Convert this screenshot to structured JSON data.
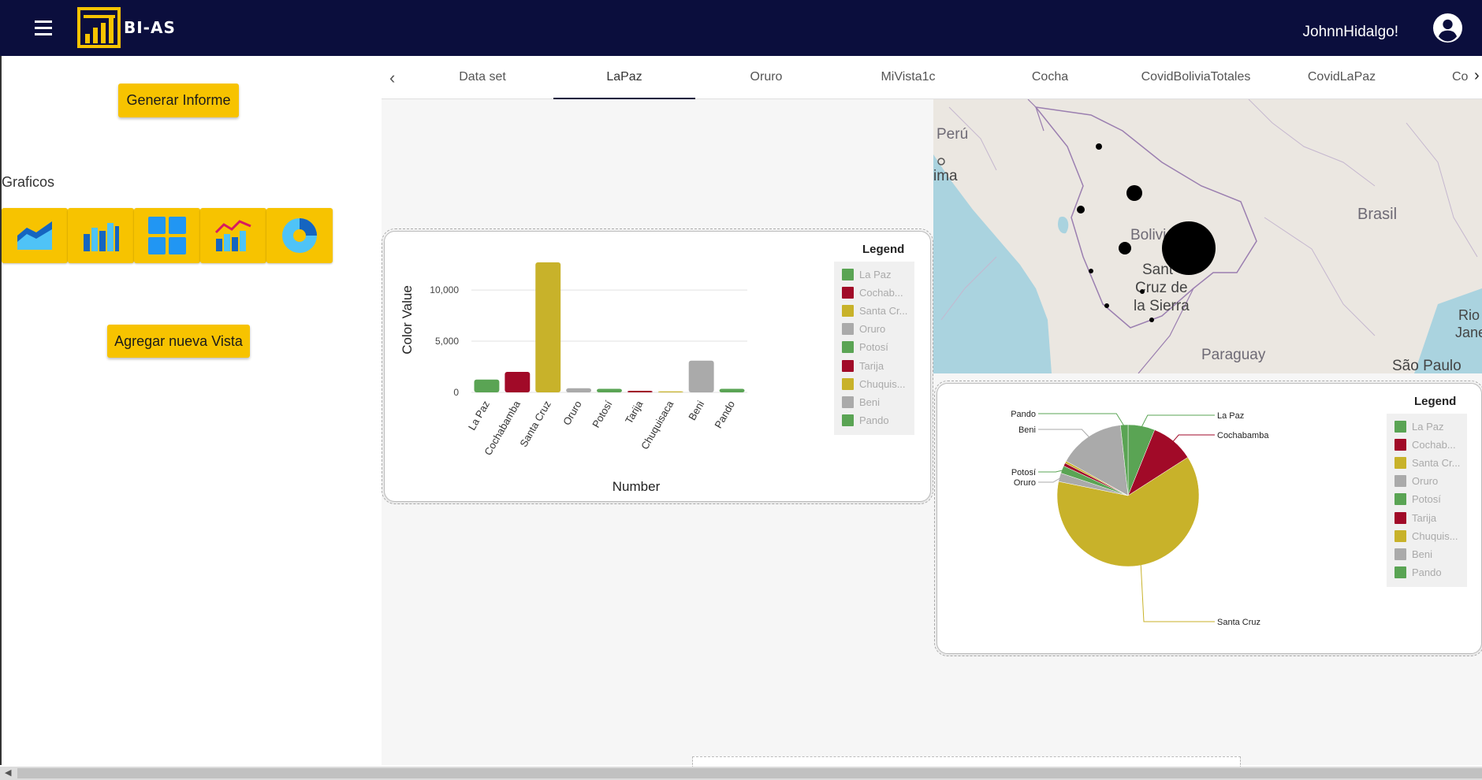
{
  "app": {
    "brand": "BI-AS",
    "user_greeting": "JohnnHidalgo!"
  },
  "colors": {
    "topbar": "#0b0e3d",
    "accent": "#f7c300",
    "series_green": "#5aa454",
    "series_red": "#a10a28",
    "series_yellow": "#c8b22a",
    "series_gray": "#aaaaaa"
  },
  "sidebar": {
    "generate_report": "Generar Informe",
    "charts_label": "Graficos",
    "add_view": "Agregar nueva Vista",
    "chart_types": [
      "area-chart-icon",
      "bar-chart-icon",
      "grid-chart-icon",
      "combo-chart-icon",
      "pie-chart-icon"
    ]
  },
  "tabs": [
    {
      "label": "Data set"
    },
    {
      "label": "LaPaz"
    },
    {
      "label": "Oruro"
    },
    {
      "label": "MiVista1c"
    },
    {
      "label": "Cocha"
    },
    {
      "label": "CovidBoliviaTotales"
    },
    {
      "label": "CovidLaPaz"
    },
    {
      "label": "Co"
    }
  ],
  "active_tab": "LaPaz",
  "map": {
    "labels": {
      "peru": "Perú",
      "lima": "ima",
      "brasil": "Brasil",
      "bolivia": "Bolivi",
      "santa_cruz_1": "Sant",
      "santa_cruz_2": "Cruz de",
      "santa_cruz_3": "la Sierra",
      "paraguay": "Paraguay",
      "sao_paulo": "São Paulo",
      "rio_1": "Rio",
      "rio_2": "Jane"
    }
  },
  "legend_title": "Legend",
  "legend_items": [
    "La Paz",
    "Cochab...",
    "Santa Cr...",
    "Oruro",
    "Potosí",
    "Tarija",
    "Chuquis...",
    "Beni",
    "Pando"
  ],
  "chart_data": [
    {
      "type": "bar",
      "categories": [
        "La Paz",
        "Cochabamba",
        "Santa Cruz",
        "Oruro",
        "Potosí",
        "Tarija",
        "Chuquisaca",
        "Beni",
        "Pando"
      ],
      "values": [
        1250,
        2000,
        12700,
        400,
        350,
        150,
        100,
        3100,
        350
      ],
      "colors": [
        "#5aa454",
        "#a10a28",
        "#c8b22a",
        "#aaaaaa",
        "#5aa454",
        "#a10a28",
        "#c8b22a",
        "#aaaaaa",
        "#5aa454"
      ],
      "ylim": [
        0,
        12700
      ],
      "yticks": [
        "0",
        "5,000",
        "10,000"
      ],
      "ytick_values": [
        0,
        5000,
        10000
      ],
      "xlabel": "Number",
      "ylabel": "Color Value",
      "grid": true,
      "legend": "right"
    },
    {
      "type": "pie",
      "categories": [
        "La Paz",
        "Cochabamba",
        "Santa Cruz",
        "Oruro",
        "Potosí",
        "Tarija",
        "Chuquisaca",
        "Beni",
        "Pando"
      ],
      "values": [
        1250,
        2000,
        12700,
        400,
        350,
        150,
        100,
        3100,
        350
      ],
      "colors": [
        "#5aa454",
        "#a10a28",
        "#c8b22a",
        "#aaaaaa",
        "#5aa454",
        "#a10a28",
        "#c8b22a",
        "#aaaaaa",
        "#5aa454"
      ],
      "slice_labels": [
        "La Paz",
        "Cochabamba",
        "Santa Cruz",
        "Oruro",
        "Potosí",
        "Beni",
        "Pando"
      ],
      "legend": "right"
    }
  ]
}
